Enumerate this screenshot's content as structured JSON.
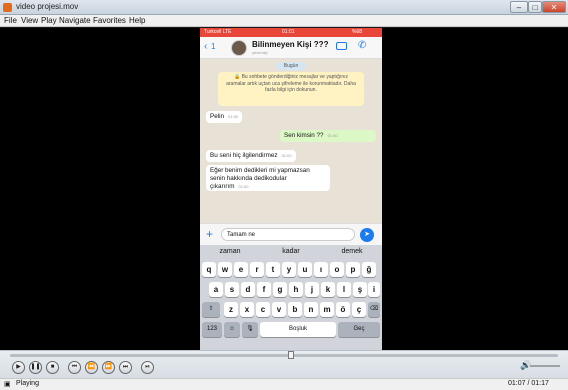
{
  "window": {
    "title": "video projesi.mov",
    "minimize_label": "–",
    "maximize_label": "□",
    "close_label": "✕"
  },
  "menu": [
    "File",
    "View",
    "Play",
    "Navigate",
    "Favorites",
    "Help"
  ],
  "phone": {
    "status": {
      "carrier": "Turkcell LTE",
      "time": "01:01",
      "battery": "%68"
    },
    "chat_header": {
      "back_count": "1",
      "name": "Bilinmeyen Kişi ???",
      "subtitle": "çevrimiçi"
    },
    "day_label": "Bugün",
    "encryption_notice": "🔒 Bu sohbete gönderdiğiniz mesajlar ve yaptığınız aramalar artık uçtan uca şifreleme ile korunmaktadır. Daha fazla bilgi için dokunun.",
    "messages": [
      {
        "dir": "in",
        "text": "Pelin",
        "time": "01:00"
      },
      {
        "dir": "out",
        "text": "Sen kimsin ??",
        "time": "01:00"
      },
      {
        "dir": "in",
        "text": "Bu seni hiç ilgilendirmez",
        "time": "01:00"
      },
      {
        "dir": "in",
        "text": "Eğer benim dedikleri mi yapmazsan senin hakkında dedikodular çıkarırım",
        "time": "01:00"
      }
    ],
    "input_value": "Tamam ne",
    "suggestions": [
      "zaman",
      "kadar",
      "demek"
    ],
    "keyboard": {
      "row1": [
        "q",
        "w",
        "e",
        "r",
        "t",
        "y",
        "u",
        "ı",
        "o",
        "p",
        "ğ"
      ],
      "row2": [
        "a",
        "s",
        "d",
        "f",
        "g",
        "h",
        "j",
        "k",
        "l",
        "ş",
        "i"
      ],
      "row3": [
        "z",
        "x",
        "c",
        "v",
        "b",
        "n",
        "m",
        "ö",
        "ç"
      ],
      "num_label": "123",
      "emoji_label": "☺",
      "mic_label": "🎙",
      "space_label": "Boşluk",
      "return_label": "Geç",
      "shift_label": "⇧",
      "delete_label": "⌫"
    }
  },
  "player": {
    "status": "Playing",
    "time": "01:07 / 01:17"
  }
}
